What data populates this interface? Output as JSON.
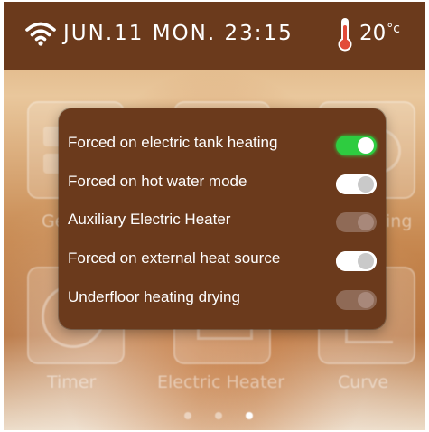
{
  "status_bar": {
    "wifi_icon": "wifi-icon",
    "datetime": "JUN.11 MON.  23:15",
    "thermometer_icon": "thermometer-icon",
    "temperature": "20",
    "temperature_unit": "°c"
  },
  "background_tiles": [
    {
      "label": "Ge",
      "icon": "general-icon"
    },
    {
      "label": "",
      "icon": "mode-icon"
    },
    {
      "label": "ing",
      "icon": "setting-icon"
    },
    {
      "label": "Timer",
      "icon": "timer-icon"
    },
    {
      "label": "Electric Heater",
      "icon": "electric-heater-icon"
    },
    {
      "label": "Curve",
      "icon": "curve-icon"
    }
  ],
  "modal": {
    "options": [
      {
        "label": "Forced on electric tank heating",
        "state": "on"
      },
      {
        "label": "Forced on hot water mode",
        "state": "off"
      },
      {
        "label": "Auxiliary Electric Heater",
        "state": "disabled"
      },
      {
        "label": "Forced on external heat source",
        "state": "off"
      },
      {
        "label": "Underfloor heating drying",
        "state": "disabled"
      }
    ]
  },
  "pagination": {
    "total": 3,
    "active": 3
  },
  "colors": {
    "status_bar_bg": "#6b3a1c",
    "modal_bg": "#6b3a1c",
    "toggle_on": "#2ecc40",
    "toggle_off": "#ffffff",
    "toggle_disabled": "#8f6a56"
  }
}
